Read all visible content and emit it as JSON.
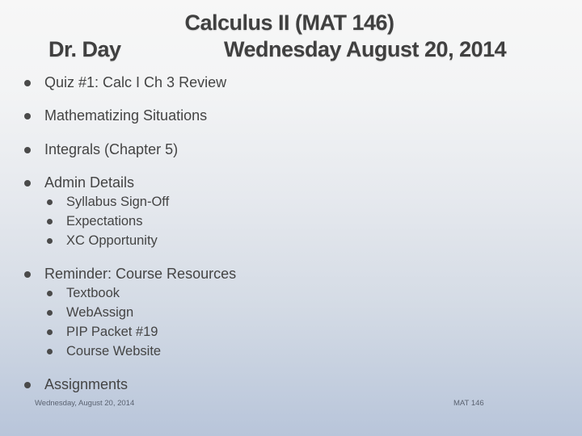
{
  "title": {
    "line1": "Calculus II (MAT 146)",
    "instructor": "Dr. Day",
    "date": "Wednesday August 20, 2014"
  },
  "bullets": [
    {
      "label": "Quiz #1: Calc I Ch 3 Review",
      "sub": []
    },
    {
      "label": "Mathematizing Situations",
      "sub": []
    },
    {
      "label": "Integrals (Chapter 5)",
      "sub": []
    },
    {
      "label": "Admin Details",
      "sub": [
        "Syllabus Sign-Off",
        "Expectations",
        "XC Opportunity"
      ]
    },
    {
      "label": "Reminder: Course Resources",
      "sub": [
        "Textbook",
        "WebAssign",
        "PIP Packet #19",
        "Course Website"
      ]
    },
    {
      "label": "Assignments",
      "sub": []
    }
  ],
  "footer": {
    "date": "Wednesday, August 20, 2014",
    "course": "MAT 146"
  },
  "colors": {
    "text": "#404040",
    "background_top": "#f7f7f7",
    "background_bottom": "#b8c5da"
  }
}
